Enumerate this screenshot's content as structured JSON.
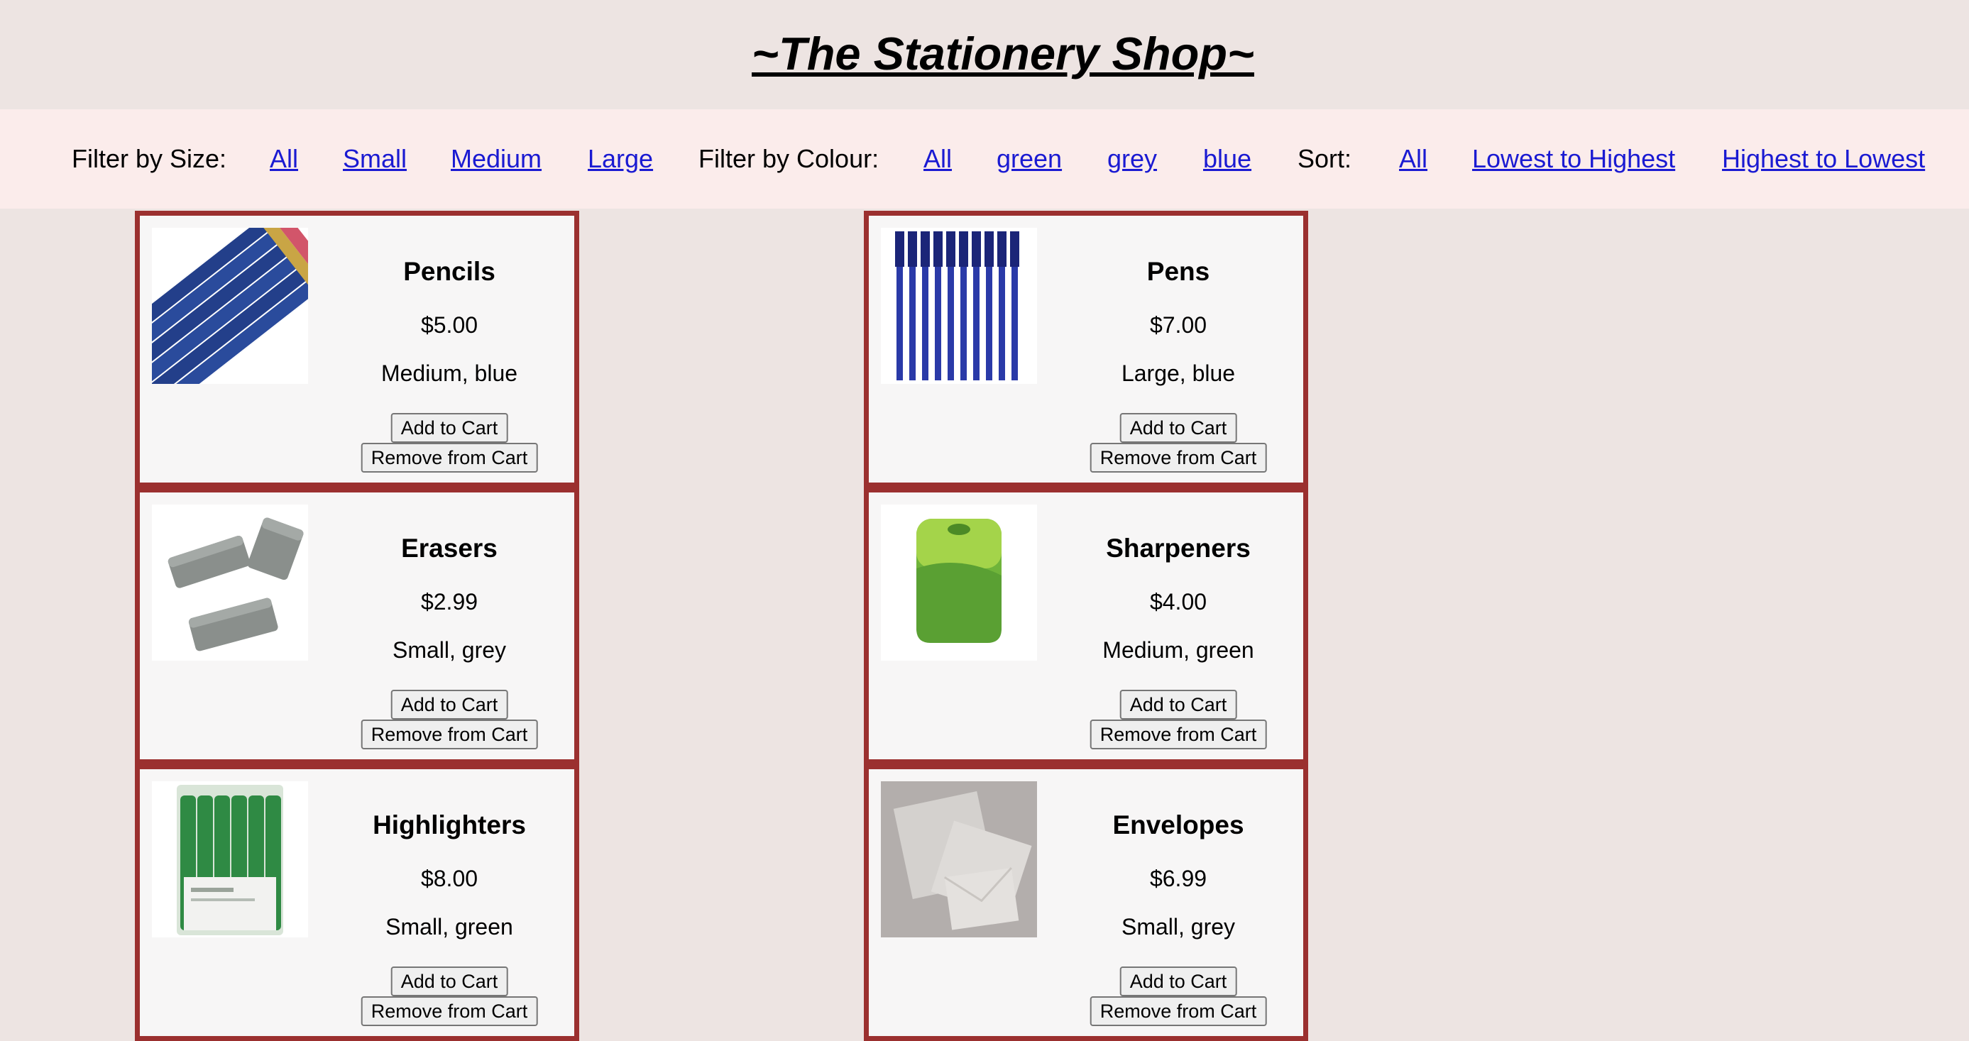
{
  "shop": {
    "title": "~The Stationery Shop~"
  },
  "filters": {
    "size_label": "Filter by Size:",
    "size_options": [
      "All",
      "Small",
      "Medium",
      "Large"
    ],
    "colour_label": "Filter by Colour:",
    "colour_options": [
      "All",
      "green",
      "grey",
      "blue"
    ],
    "sort_label": "Sort:",
    "sort_options": [
      "All",
      "Lowest to Highest",
      "Highest to Lowest"
    ]
  },
  "buttons": {
    "add": "Add to Cart",
    "remove": "Remove from Cart"
  },
  "products": [
    {
      "name": "Pencils",
      "price": "$5.00",
      "attrs": "Medium, blue",
      "icon": "pencils-image"
    },
    {
      "name": "Pens",
      "price": "$7.00",
      "attrs": "Large, blue",
      "icon": "pens-image"
    },
    {
      "name": "Erasers",
      "price": "$2.99",
      "attrs": "Small, grey",
      "icon": "erasers-image"
    },
    {
      "name": "Sharpeners",
      "price": "$4.00",
      "attrs": "Medium, green",
      "icon": "sharpener-image"
    },
    {
      "name": "Highlighters",
      "price": "$8.00",
      "attrs": "Small, green",
      "icon": "highlighters-image"
    },
    {
      "name": "Envelopes",
      "price": "$6.99",
      "attrs": "Small, grey",
      "icon": "envelopes-image"
    }
  ],
  "colors": {
    "card_border": "#9b302f",
    "link": "#1a1ad2",
    "filter_bg": "#fbeceb",
    "page_bg": "#ede4e2"
  }
}
